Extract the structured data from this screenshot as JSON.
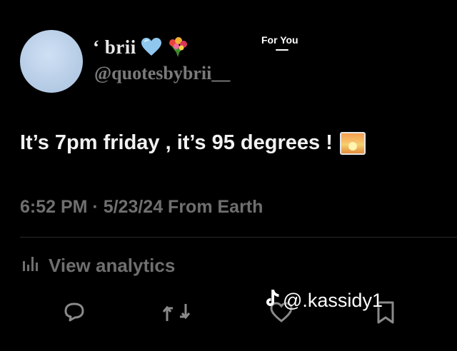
{
  "header": {
    "tab_label": "For You"
  },
  "tweet": {
    "display_name": "‘ brii",
    "name_icons": [
      "light-blue-heart-icon",
      "bouquet-icon"
    ],
    "handle": "@quotesbybrii__",
    "text": "It’s 7pm friday , it’s 95 degrees !",
    "text_icon": "sunset-icon",
    "meta": "6:52 PM · 5/23/24 From Earth",
    "analytics_label": "View analytics"
  },
  "actions": [
    "reply-icon",
    "retweet-icon",
    "like-icon",
    "bookmark-icon"
  ],
  "watermark": {
    "text": "@.kassidy1",
    "icon": "tiktok-icon"
  },
  "colors": {
    "background": "#000000",
    "primary_text": "#f2f2f2",
    "secondary_text": "#6f6f6f",
    "avatar": "#b7cde6",
    "heart": "#8fc7ef"
  }
}
